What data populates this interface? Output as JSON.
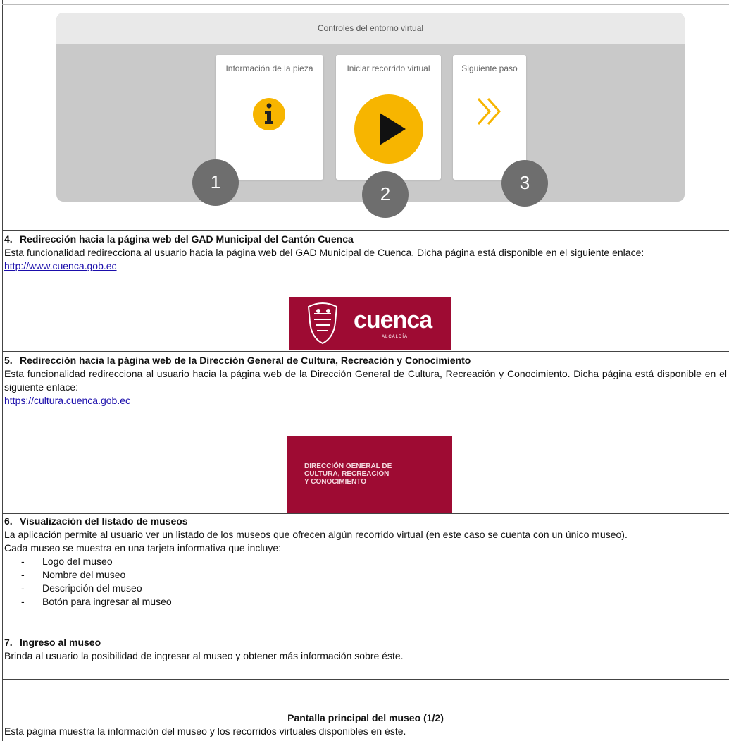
{
  "mockup": {
    "header": "Controles del entorno virtual",
    "cards": [
      {
        "label": "Información de la pieza"
      },
      {
        "label": "Iniciar recorrido virtual"
      },
      {
        "label": "Siguiente paso"
      }
    ],
    "badges": [
      "1",
      "2",
      "3"
    ],
    "colors": {
      "accent": "#f7b500",
      "badge": "#6e6e6e"
    }
  },
  "sections": [
    {
      "number": "4.",
      "title": "Redirección hacia la página web del GAD Municipal del Cantón Cuenca",
      "body": "Esta funcionalidad redirecciona al usuario hacia la página web del GAD Municipal de Cuenca. Dicha página está disponible en el siguiente enlace:",
      "link": "http://www.cuenca.gob.ec",
      "logo": {
        "name": "cuenca",
        "sub": "ALCALDÍA",
        "bg": "#9e0b33"
      }
    },
    {
      "number": "5.",
      "title": "Redirección hacia la página web de la Dirección General de Cultura, Recreación y Conocimiento",
      "body": "Esta funcionalidad redirecciona al usuario hacia la página web de la Dirección General de Cultura, Recreación y Conocimiento. Dicha página está disponible en el siguiente enlace:",
      "link": "https://cultura.cuenca.gob.ec",
      "logo": {
        "line1": "DIRECCIÓN GENERAL DE",
        "line2": "CULTURA, RECREACIÓN",
        "line3": "Y CONOCIMIENTO",
        "bg": "#9e0b33"
      }
    },
    {
      "number": "6.",
      "title": "Visualización del listado de museos",
      "body": "La aplicación permite al usuario ver un listado de los museos que ofrecen algún recorrido virtual (en este caso se cuenta con un único museo).",
      "body2": "Cada museo se muestra en una tarjeta informativa que incluye:",
      "items": [
        "Logo del museo",
        "Nombre del museo",
        "Descripción del museo",
        "Botón para ingresar al museo"
      ]
    },
    {
      "number": "7.",
      "title": "Ingreso al museo",
      "body": "Brinda al usuario la posibilidad de ingresar al museo y obtener más información sobre éste."
    }
  ],
  "screen": {
    "title": "Pantalla principal del museo (1/2)",
    "body": "Esta página muestra la información del museo y los recorridos virtuales disponibles en éste."
  }
}
